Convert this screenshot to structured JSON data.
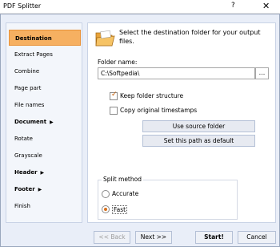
{
  "window": {
    "title": "PDF Splitter",
    "help_label": "?",
    "close_label": "✕"
  },
  "sidebar": {
    "items": [
      {
        "label": "Destination",
        "active": true
      },
      {
        "label": "Extract Pages"
      },
      {
        "label": "Combine"
      },
      {
        "label": "Page part"
      },
      {
        "label": "File names"
      },
      {
        "label": "Document",
        "bold": true,
        "arrow": "▶"
      },
      {
        "label": "Rotate"
      },
      {
        "label": "Grayscale"
      },
      {
        "label": "Header",
        "bold": true,
        "arrow": "▶"
      },
      {
        "label": "Footer",
        "bold": true,
        "arrow": "▶"
      },
      {
        "label": "Finish"
      }
    ]
  },
  "main": {
    "header_text": "Select the destination folder for your output files.",
    "folder_label": "Folder name:",
    "folder_value": "C:\\Softpedia\\",
    "browse_label": "...",
    "keep_structure": {
      "label": "Keep folder structure",
      "checked": true
    },
    "copy_timestamps": {
      "label": "Copy original timestamps",
      "checked": false
    },
    "use_source_label": "Use source folder",
    "set_default_label": "Set this path as default",
    "split_method": {
      "title": "Split method",
      "options": [
        {
          "label": "Accurate",
          "selected": false
        },
        {
          "label": "Fast",
          "selected": true
        }
      ]
    }
  },
  "footer": {
    "back_label": "<< Back",
    "next_label": "Next >>",
    "start_label": "Start!",
    "cancel_label": "Cancel"
  },
  "colors": {
    "accent": "#f6b061",
    "accent_border": "#e9933b",
    "window_bg": "#e9eef8"
  }
}
